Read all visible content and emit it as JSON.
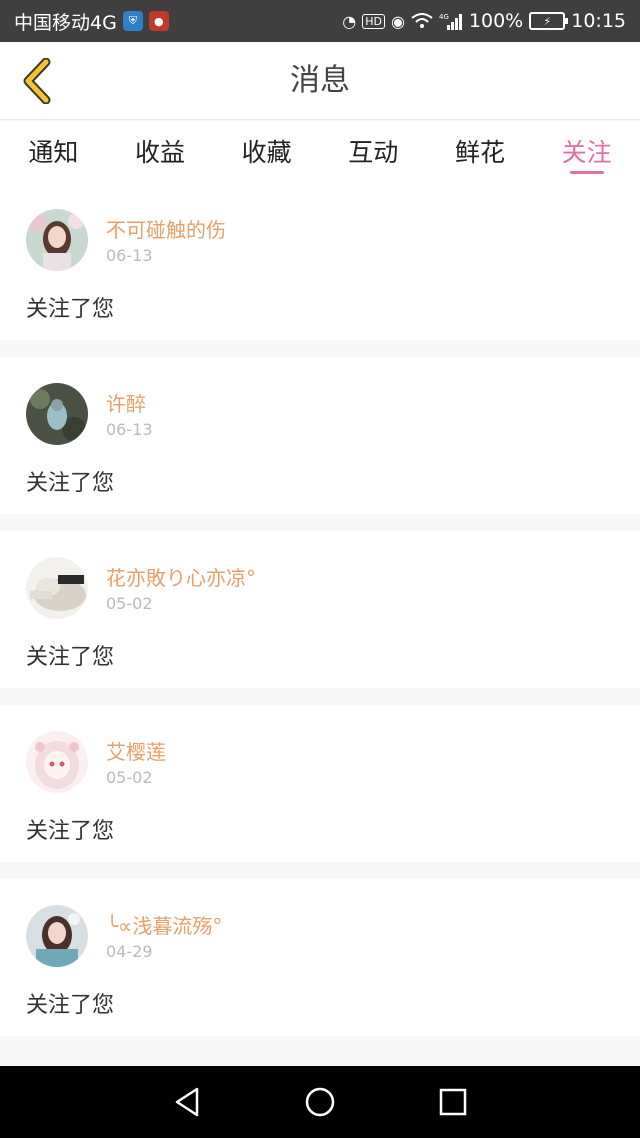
{
  "status_bar": {
    "carrier": "中国移动4G",
    "hd": "HD",
    "network": "4G",
    "battery": "100%",
    "time": "10:15"
  },
  "header": {
    "title": "消息"
  },
  "tabs": [
    {
      "label": "通知",
      "active": false
    },
    {
      "label": "收益",
      "active": false
    },
    {
      "label": "收藏",
      "active": false
    },
    {
      "label": "互动",
      "active": false
    },
    {
      "label": "鲜花",
      "active": false
    },
    {
      "label": "关注",
      "active": true
    }
  ],
  "messages": [
    {
      "name": "不可碰触的伤",
      "date": "06-13",
      "text": "关注了您"
    },
    {
      "name": "许醉",
      "date": "06-13",
      "text": "关注了您"
    },
    {
      "name": "花亦敗り心亦凉°",
      "date": "05-02",
      "text": "关注了您"
    },
    {
      "name": "艾樱莲",
      "date": "05-02",
      "text": "关注了您"
    },
    {
      "name": "╰∝浅暮流殇°",
      "date": "04-29",
      "text": "关注了您"
    }
  ],
  "colors": {
    "accent": "#e76ea0",
    "name": "#e8a06a",
    "date": "#bbbbbb"
  }
}
